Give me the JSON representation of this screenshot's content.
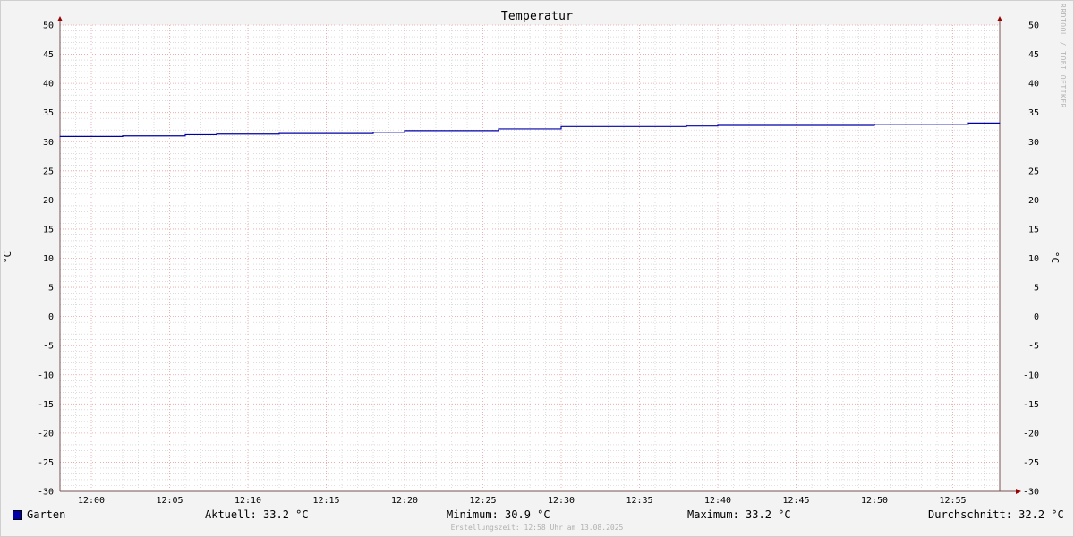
{
  "chart_data": {
    "type": "line",
    "title": "Temperatur",
    "ylabel": "°C",
    "ylim": [
      -30,
      50
    ],
    "yticks": [
      50,
      45,
      40,
      35,
      30,
      25,
      20,
      15,
      10,
      5,
      0,
      -5,
      -10,
      -15,
      -20,
      -25,
      -30
    ],
    "xlim": [
      "11:58",
      "12:58"
    ],
    "xticks": [
      "12:00",
      "12:05",
      "12:10",
      "12:15",
      "12:20",
      "12:25",
      "12:30",
      "12:35",
      "12:40",
      "12:45",
      "12:50",
      "12:55"
    ],
    "grid": true,
    "series": [
      {
        "name": "Garten",
        "color": "#0000aa",
        "points": [
          [
            "11:58",
            30.9
          ],
          [
            "12:02",
            31.0
          ],
          [
            "12:06",
            31.2
          ],
          [
            "12:08",
            31.3
          ],
          [
            "12:12",
            31.4
          ],
          [
            "12:18",
            31.6
          ],
          [
            "12:20",
            31.9
          ],
          [
            "12:26",
            32.2
          ],
          [
            "12:30",
            32.6
          ],
          [
            "12:38",
            32.7
          ],
          [
            "12:40",
            32.8
          ],
          [
            "12:50",
            33.0
          ],
          [
            "12:56",
            33.2
          ],
          [
            "12:58",
            33.2
          ]
        ]
      }
    ]
  },
  "legend": {
    "series_name": "Garten",
    "current": "Aktuell: 33.2 °C",
    "minimum": "Minimum: 30.9 °C",
    "maximum": "Maximum: 33.2 °C",
    "average": "Durchschnitt: 32.2 °C"
  },
  "footer": "Erstellungszeit: 12:58 Uhr am 13.08.2025",
  "watermark": "RRDTOOL / TOBI OETIKER",
  "colors": {
    "major_grid": "#e8a0a0",
    "minor_grid": "#c8c8c8",
    "axis": "#7a5050",
    "arrow": "#990000",
    "plot_bg": "#ffffff"
  }
}
